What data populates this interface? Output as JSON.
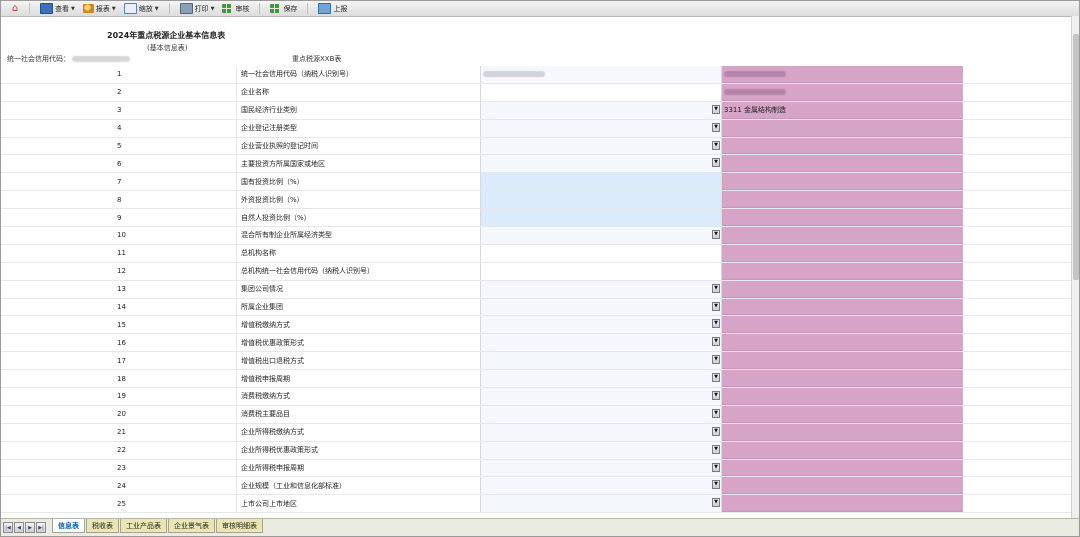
{
  "toolbar": {
    "items": [
      {
        "label": "查看",
        "dropdown": true,
        "icon": "monitor-icon"
      },
      {
        "label": "报表",
        "dropdown": true,
        "icon": "report-icon"
      },
      {
        "label": "缩放",
        "dropdown": true,
        "icon": "zoom-icon"
      },
      {
        "label": "打印",
        "dropdown": true,
        "icon": "print-icon"
      },
      {
        "label": "审核",
        "dropdown": false,
        "icon": "grid-icon"
      },
      {
        "label": "保存",
        "dropdown": false,
        "icon": "grid-icon"
      },
      {
        "label": "上报",
        "dropdown": false,
        "icon": "upload-icon"
      }
    ]
  },
  "header": {
    "title": "2024年重点税源企业基本信息表",
    "subtitle": "(基本信息表)",
    "code_label": "统一社会信用代码：",
    "table_code": "重点税源XXB表"
  },
  "rows": [
    {
      "num": "1",
      "label": "统一社会信用代码（纳税人识别号）",
      "input": "blurred",
      "ref": "blurred"
    },
    {
      "num": "2",
      "label": "企业名称",
      "input": "plain",
      "ref": "blurred"
    },
    {
      "num": "3",
      "label": "国民经济行业类别",
      "input": "select",
      "ref_text": "3311 金属结构制造"
    },
    {
      "num": "4",
      "label": "企业登记注册类型",
      "input": "select"
    },
    {
      "num": "5",
      "label": "企业营业执照的登记时间",
      "input": "select"
    },
    {
      "num": "6",
      "label": "主要投资方所属国家或地区",
      "input": "select"
    },
    {
      "num": "7",
      "label": "国有投资比例（%）",
      "input": "pct"
    },
    {
      "num": "8",
      "label": "外资投资比例（%）",
      "input": "pct"
    },
    {
      "num": "9",
      "label": "自然人投资比例（%）",
      "input": "pct"
    },
    {
      "num": "10",
      "label": "混合所有制企业所属经济类型",
      "input": "select"
    },
    {
      "num": "11",
      "label": "总机构名称",
      "input": "plain"
    },
    {
      "num": "12",
      "label": "总机构统一社会信用代码（纳税人识别号）",
      "input": "plain"
    },
    {
      "num": "13",
      "label": "集团公司情况",
      "input": "select"
    },
    {
      "num": "14",
      "label": "所属企业集团",
      "input": "select"
    },
    {
      "num": "15",
      "label": "增值税缴纳方式",
      "input": "select"
    },
    {
      "num": "16",
      "label": "增值税优惠政策形式",
      "input": "select"
    },
    {
      "num": "17",
      "label": "增值税出口退税方式",
      "input": "select"
    },
    {
      "num": "18",
      "label": "增值税申报周期",
      "input": "select"
    },
    {
      "num": "19",
      "label": "消费税缴纳方式",
      "input": "select"
    },
    {
      "num": "20",
      "label": "消费税主要品目",
      "input": "select"
    },
    {
      "num": "21",
      "label": "企业所得税缴纳方式",
      "input": "select"
    },
    {
      "num": "22",
      "label": "企业所得税优惠政策形式",
      "input": "select"
    },
    {
      "num": "23",
      "label": "企业所得税申报周期",
      "input": "select"
    },
    {
      "num": "24",
      "label": "企业规模（工业和信息化部标准）",
      "input": "select"
    },
    {
      "num": "25",
      "label": "上市公司上市地区",
      "input": "select"
    }
  ],
  "tabs": [
    {
      "label": "信息表",
      "active": true
    },
    {
      "label": "税收表",
      "active": false
    },
    {
      "label": "工业产品表",
      "active": false
    },
    {
      "label": "企业景气表",
      "active": false
    },
    {
      "label": "审核明细表",
      "active": false
    }
  ],
  "colors": {
    "reference_column": "#d6a4c6",
    "percent_input": "#dcebfb",
    "active_tab_text": "#0b5fa8"
  }
}
